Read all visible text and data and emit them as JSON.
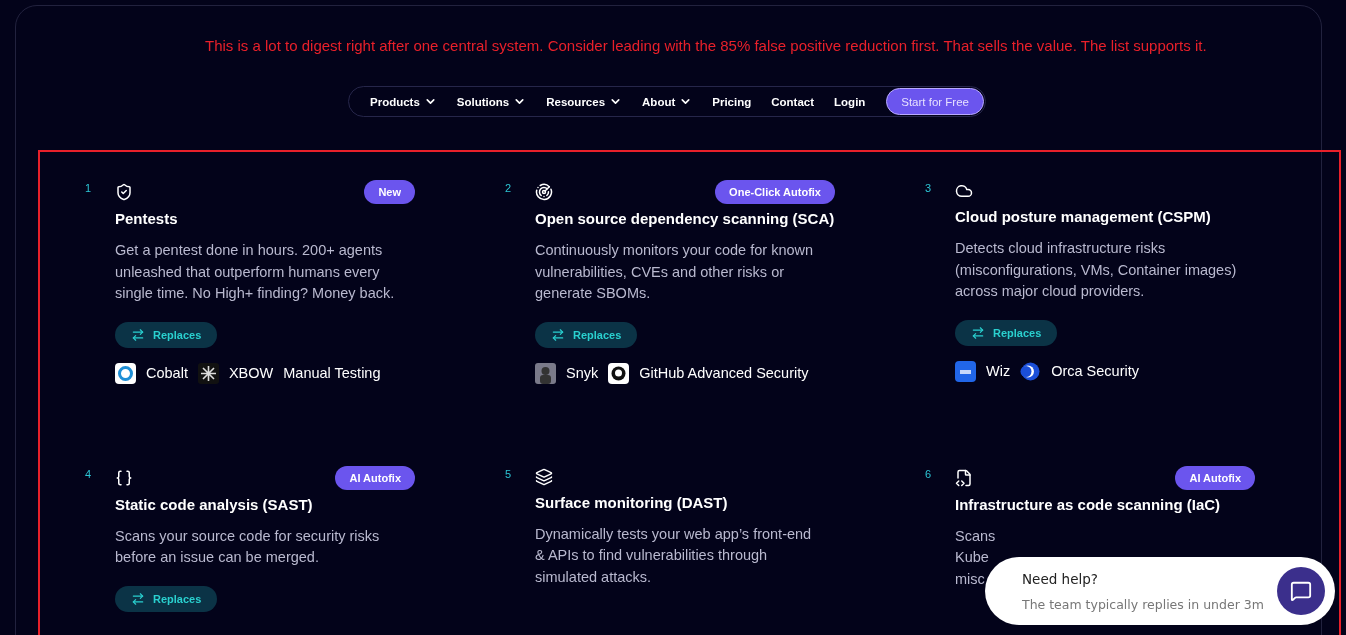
{
  "note": "This is a lot to digest right after one central system. Consider leading with the 85% false positive reduction first. That sells the value. The list supports it.",
  "nav": {
    "items": [
      {
        "label": "Products",
        "has_menu": true
      },
      {
        "label": "Solutions",
        "has_menu": true
      },
      {
        "label": "Resources",
        "has_menu": true
      },
      {
        "label": "About",
        "has_menu": true
      },
      {
        "label": "Pricing",
        "has_menu": false
      },
      {
        "label": "Contact",
        "has_menu": false
      },
      {
        "label": "Login",
        "has_menu": false
      }
    ],
    "cta": "Start for Free"
  },
  "cards": [
    {
      "number": "1",
      "badge": "New",
      "title": "Pentests",
      "lines": [
        "Get a pentest done in hours. 200+ agents",
        "unleashed that outperform humans every",
        "single time. No High+ finding? Money back."
      ],
      "replaces": "Replaces",
      "vendors": [
        {
          "name": "Cobalt",
          "kind": "c"
        },
        {
          "name": "XBOW",
          "kind": "star"
        },
        {
          "name": "Manual Testing"
        }
      ]
    },
    {
      "number": "2",
      "badge": "One-Click Autofix",
      "title": "Open source dependency scanning (SCA)",
      "lines": [
        "Continuously monitors your code for known",
        "vulnerabilities, CVEs and other risks or",
        "generate SBOMs."
      ],
      "replaces": "Replaces",
      "vendors": [
        {
          "name": "Snyk",
          "kind": "figure"
        },
        {
          "name": "GitHub Advanced Security",
          "kind": "cat"
        }
      ]
    },
    {
      "number": "3",
      "title": "Cloud posture management (CSPM)",
      "lines": [
        "Detects cloud infrastructure risks",
        "(misconfigurations, VMs, Container images)",
        "across major cloud providers."
      ],
      "replaces": "Replaces",
      "vendors": [
        {
          "name": "Wiz",
          "kind": "tile"
        },
        {
          "name": "Orca Security",
          "kind": "crescent"
        }
      ]
    },
    {
      "number": "4",
      "badge": "AI Autofix",
      "title": "Static code analysis (SAST)",
      "lines": [
        "Scans your source code for security risks",
        "before an issue can be merged."
      ],
      "replaces": "Replaces"
    },
    {
      "number": "5",
      "title": "Surface monitoring (DAST)",
      "lines": [
        "Dynamically tests your web app’s front-end",
        "& APIs to find vulnerabilities through",
        "simulated attacks."
      ]
    },
    {
      "number": "6",
      "badge": "AI Autofix",
      "title": "Infrastructure as code scanning (IaC)",
      "lines": [
        "Scans",
        "Kube",
        "misc"
      ]
    }
  ],
  "chat": {
    "title": "Need help?",
    "subtitle": "The team typically replies in under 3m"
  }
}
